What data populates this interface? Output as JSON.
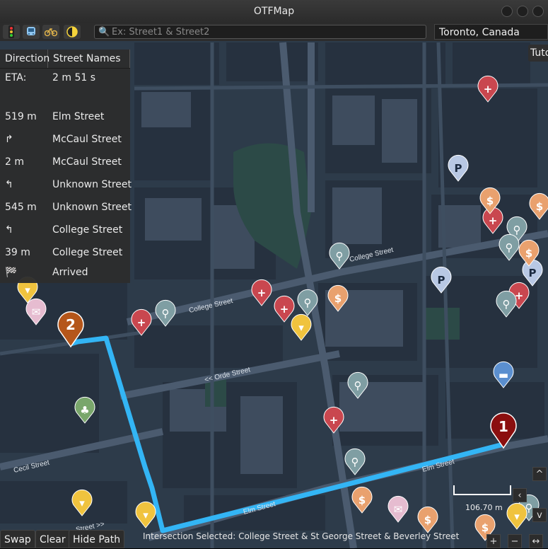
{
  "window": {
    "title": "OTFMap"
  },
  "toolbar": {
    "icons": [
      "traffic-light-icon",
      "transit-icon",
      "bicycle-icon",
      "contrast-icon"
    ],
    "search_placeholder": "Ex: Street1 & Street2",
    "location": "Toronto, Canada"
  },
  "directions": {
    "header_direction": "Direction",
    "header_street": "Street Names",
    "eta_label": "ETA:",
    "eta_value": "2 m 51 s",
    "rows": [
      {
        "direction": "519 m",
        "street": "Elm Street"
      },
      {
        "direction": "↱",
        "street": "McCaul Street"
      },
      {
        "direction": "2 m",
        "street": "McCaul Street"
      },
      {
        "direction": "↰",
        "street": "Unknown Street"
      },
      {
        "direction": "545 m",
        "street": "Unknown Street"
      },
      {
        "direction": "↰",
        "street": "College Street"
      },
      {
        "direction": "39 m",
        "street": "College Street"
      },
      {
        "direction": "🏁",
        "street": "Arrived"
      }
    ]
  },
  "tutorial_button": "Tuto",
  "map": {
    "street_labels": [
      "College Street",
      "College Street",
      "<< Orde Street",
      "Elm Street",
      "Elm Street",
      "Cecil Street",
      "Street >>"
    ],
    "markers": {
      "start": "1",
      "end": "2"
    },
    "scale_label": "106.70 m",
    "route_color": "#33b5f5"
  },
  "bottom": {
    "swap": "Swap",
    "clear": "Clear",
    "hide_path": "Hide Path",
    "status": "Intersection Selected: College Street & St George Street & Beverley Street"
  }
}
